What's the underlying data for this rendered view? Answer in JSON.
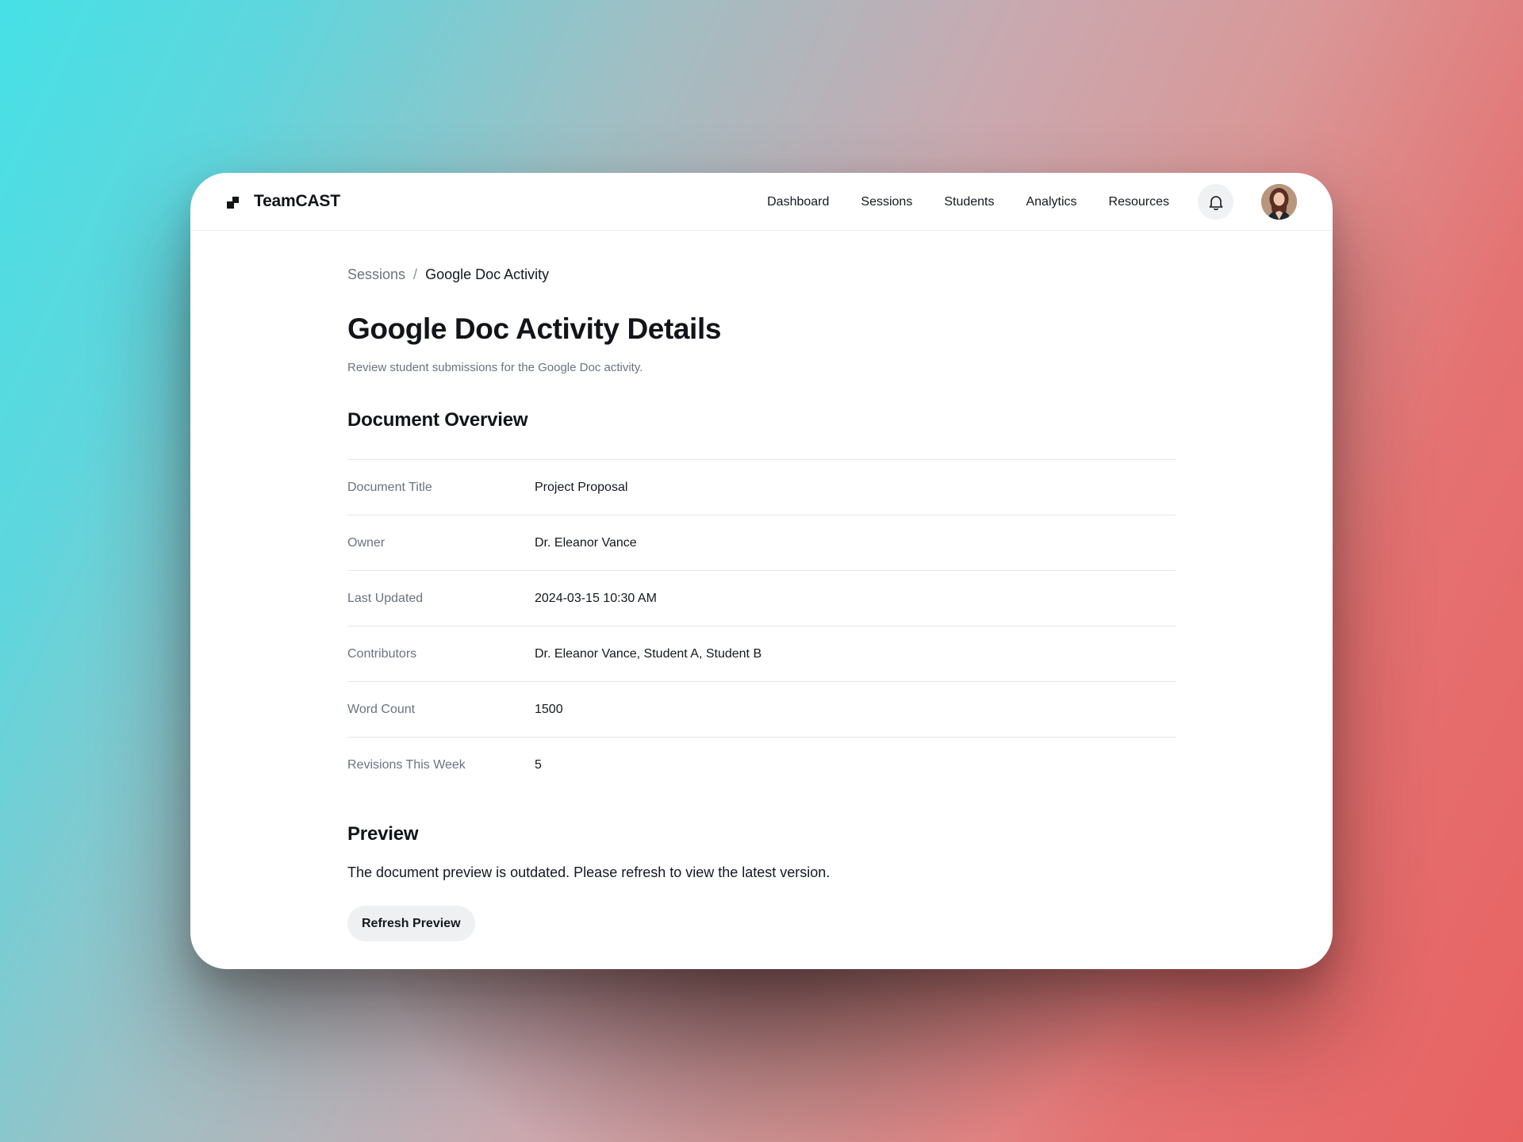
{
  "app": {
    "name": "TeamCAST",
    "logo_icon": "logo-mark-icon"
  },
  "nav": {
    "items": [
      {
        "label": "Dashboard"
      },
      {
        "label": "Sessions"
      },
      {
        "label": "Students"
      },
      {
        "label": "Analytics"
      },
      {
        "label": "Resources"
      }
    ],
    "notifications_icon": "bell-icon",
    "avatar": "user-avatar"
  },
  "breadcrumb": {
    "parent": "Sessions",
    "separator": "/",
    "current": "Google Doc Activity"
  },
  "page": {
    "title": "Google Doc Activity Details",
    "subtitle": "Review student submissions for the Google Doc activity."
  },
  "overview": {
    "title": "Document Overview",
    "rows": [
      {
        "label": "Document Title",
        "value": "Project Proposal"
      },
      {
        "label": "Owner",
        "value": "Dr. Eleanor Vance"
      },
      {
        "label": "Last Updated",
        "value": "2024-03-15 10:30 AM"
      },
      {
        "label": "Contributors",
        "value": "Dr. Eleanor Vance, Student A, Student B"
      },
      {
        "label": "Word Count",
        "value": "1500"
      },
      {
        "label": "Revisions This Week",
        "value": "5"
      }
    ]
  },
  "preview": {
    "title": "Preview",
    "message": "The document preview is outdated. Please refresh to view the latest version.",
    "button_label": "Refresh Preview"
  },
  "colors": {
    "text_primary": "#141820",
    "text_muted": "#6b7380",
    "button_bg": "#eff0f2",
    "background_left": "#46e1e6",
    "background_right": "#e86262"
  }
}
